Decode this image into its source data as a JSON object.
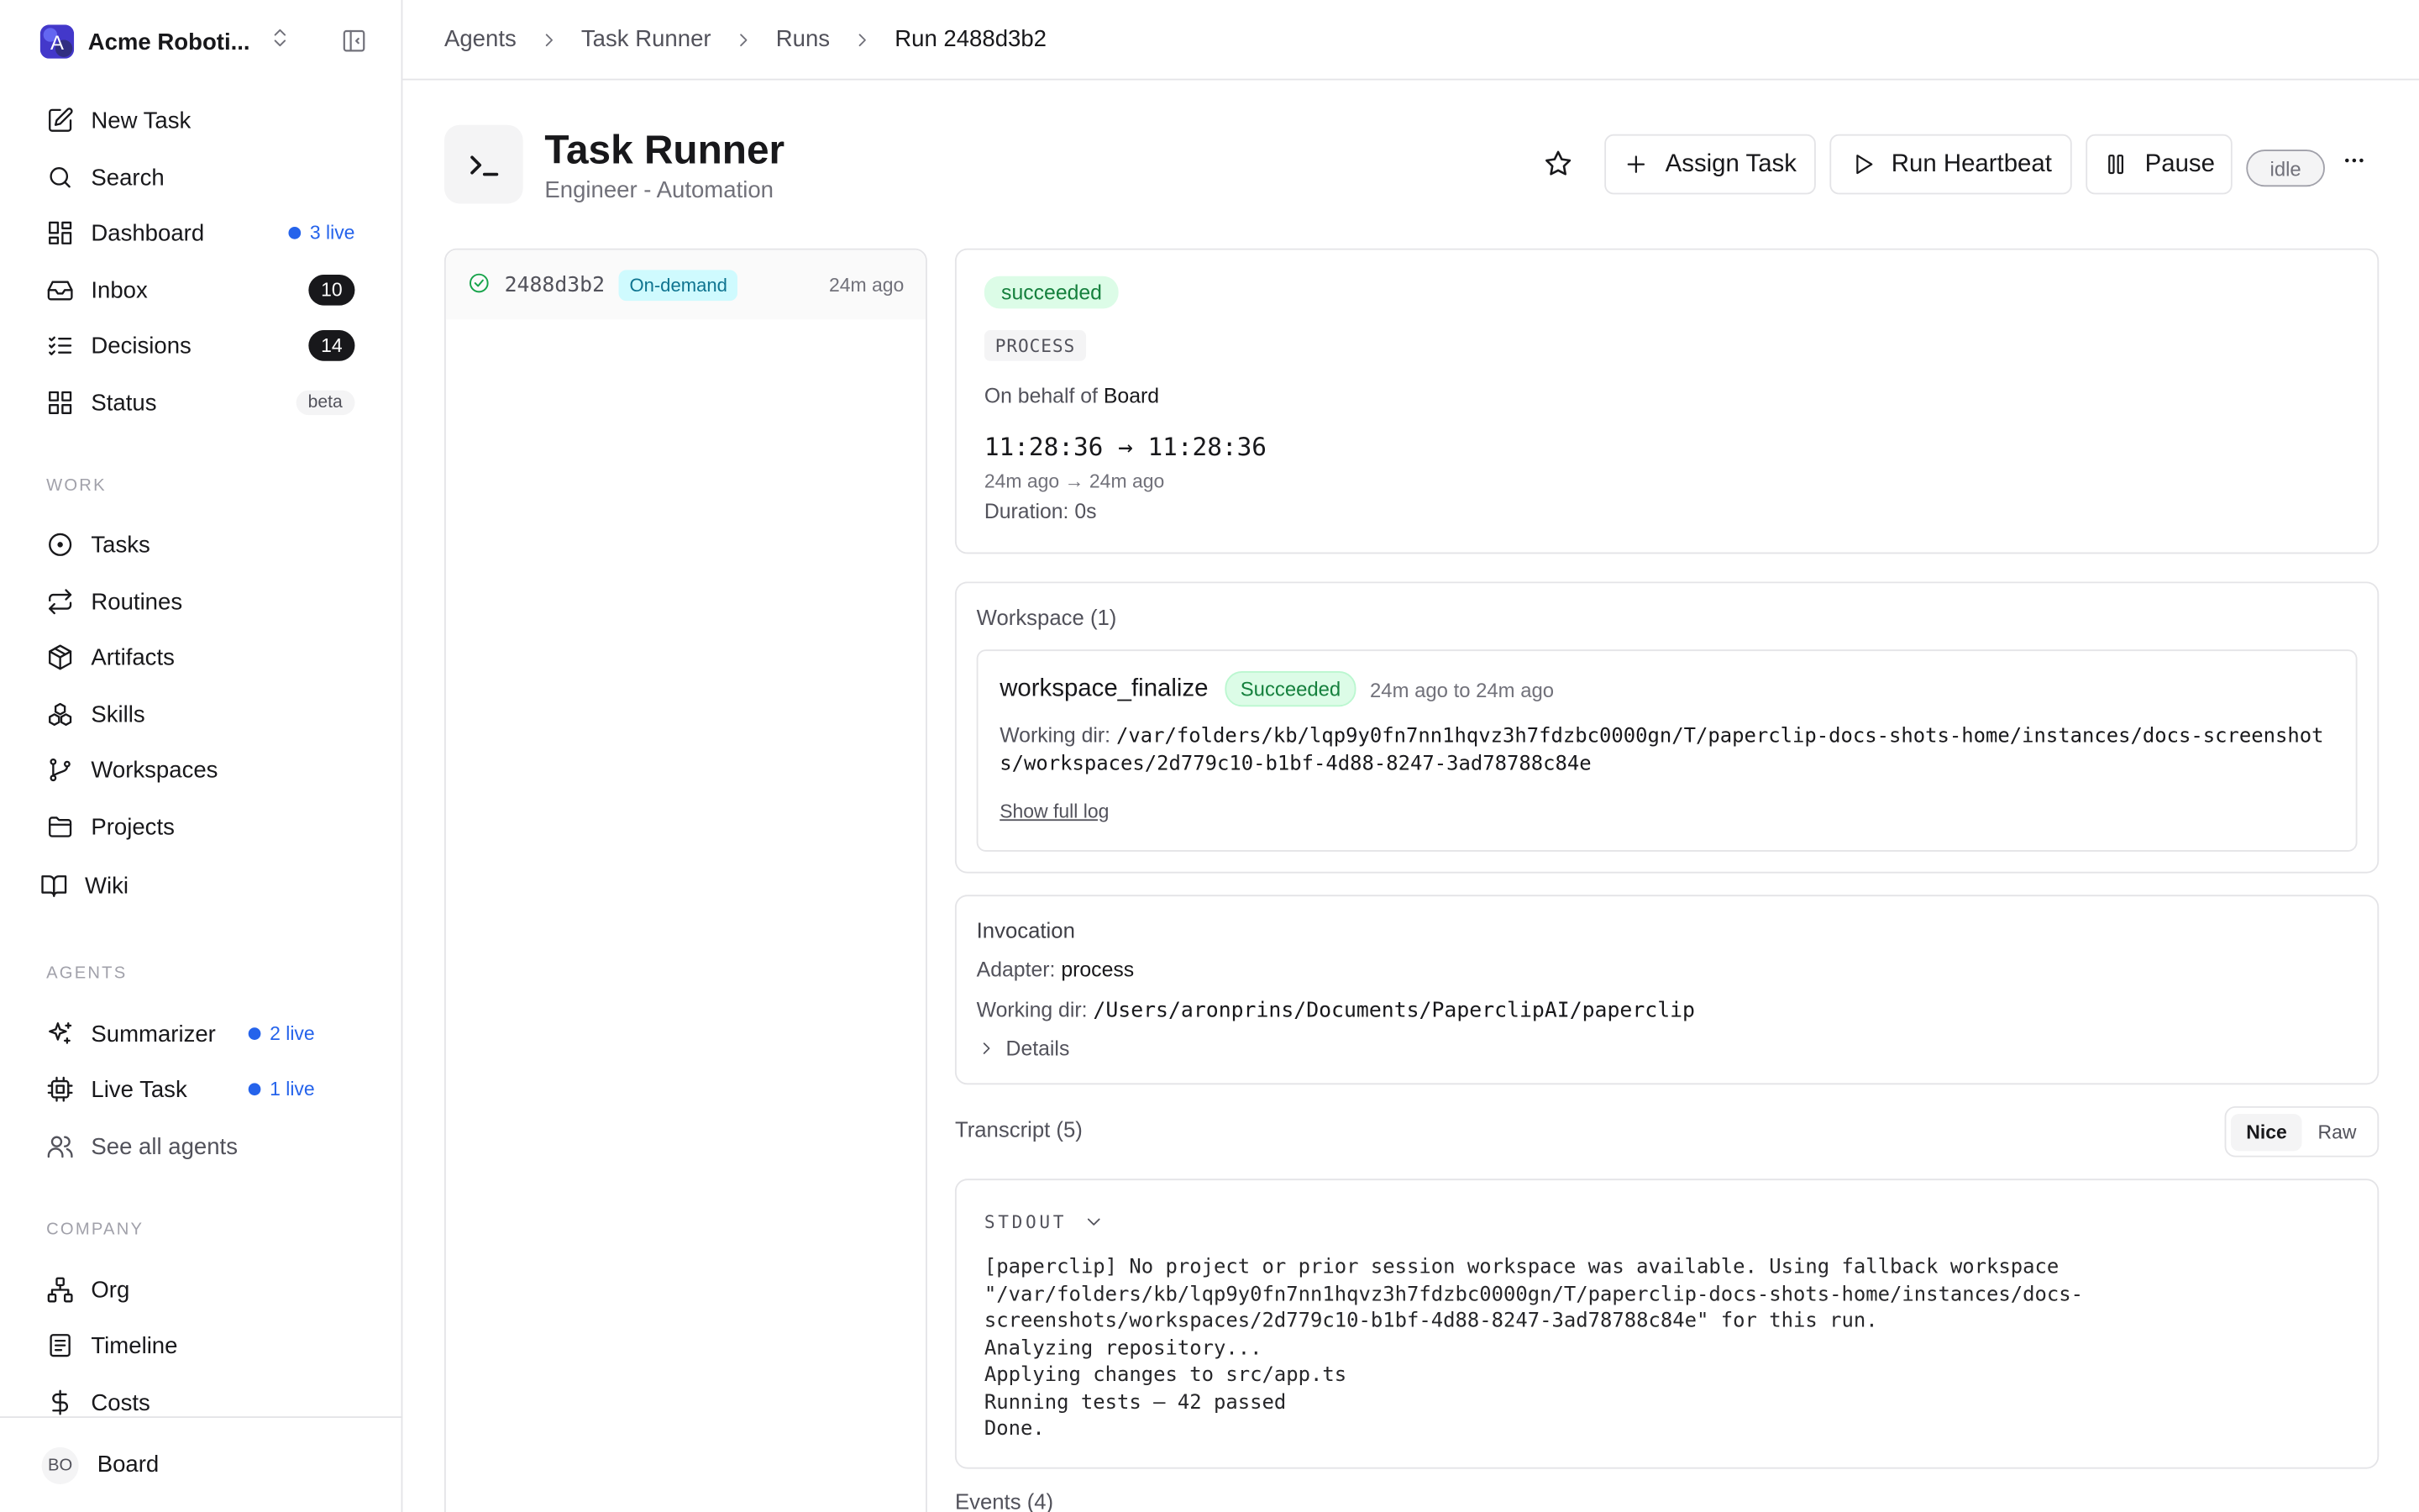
{
  "sidebar": {
    "company_name": "Acme Roboti...",
    "company_initial": "A",
    "main_items": [
      {
        "label": "New Task",
        "icon": "edit-icon"
      },
      {
        "label": "Search",
        "icon": "search-icon"
      },
      {
        "label": "Dashboard",
        "icon": "dashboard-icon",
        "live": "3 live"
      },
      {
        "label": "Inbox",
        "icon": "inbox-icon",
        "count": "10"
      },
      {
        "label": "Decisions",
        "icon": "list-check-icon",
        "count": "14"
      },
      {
        "label": "Status",
        "icon": "grid-icon",
        "badge": "beta"
      }
    ],
    "work_heading": "WORK",
    "work_items": [
      {
        "label": "Tasks",
        "icon": "circle-dot-icon"
      },
      {
        "label": "Routines",
        "icon": "repeat-icon"
      },
      {
        "label": "Artifacts",
        "icon": "package-icon"
      },
      {
        "label": "Skills",
        "icon": "boxes-icon"
      },
      {
        "label": "Workspaces",
        "icon": "git-branch-icon"
      },
      {
        "label": "Projects",
        "icon": "folder-icon"
      },
      {
        "label": "Wiki",
        "icon": "book-icon"
      }
    ],
    "agents_heading": "AGENTS",
    "agent_items": [
      {
        "label": "Summarizer",
        "icon": "sparkles-icon",
        "live": "2 live"
      },
      {
        "label": "Live Task",
        "icon": "cpu-icon",
        "live": "1 live"
      },
      {
        "label": "See all agents",
        "icon": "users-icon"
      }
    ],
    "company_heading": "COMPANY",
    "company_items": [
      {
        "label": "Org",
        "icon": "org-chart-icon"
      },
      {
        "label": "Timeline",
        "icon": "timeline-icon"
      },
      {
        "label": "Costs",
        "icon": "dollar-icon"
      }
    ],
    "user": {
      "initials": "BO",
      "name": "Board"
    }
  },
  "breadcrumb": [
    "Agents",
    "Task Runner",
    "Runs",
    "Run 2488d3b2"
  ],
  "agent": {
    "name": "Task Runner",
    "role": "Engineer - Automation",
    "actions": {
      "assign": "Assign Task",
      "heartbeat": "Run Heartbeat",
      "pause": "Pause"
    },
    "status": "idle"
  },
  "runs": [
    {
      "id": "2488d3b2",
      "trigger": "On-demand",
      "ago": "24m ago",
      "status": "success"
    }
  ],
  "run": {
    "status": "succeeded",
    "kind": "PROCESS",
    "behalf_prefix": "On behalf of",
    "behalf": "Board",
    "time_range": "11:28:36 → 11:28:36",
    "ago_range": "24m ago → 24m ago",
    "duration": "Duration: 0s"
  },
  "workspace": {
    "title": "Workspace (1)",
    "name": "workspace_finalize",
    "status": "Succeeded",
    "range": "24m ago to 24m ago",
    "dir_label": "Working dir:",
    "dir": "/var/folders/kb/lqp9y0fn7nn1hqvz3h7fdzbc0000gn/T/paperclip-docs-shots-home/instances/docs-screenshots/workspaces/2d779c10-b1bf-4d88-8247-3ad78788c84e",
    "log_link": "Show full log"
  },
  "invocation": {
    "title": "Invocation",
    "adapter_label": "Adapter:",
    "adapter": "process",
    "dir_label": "Working dir:",
    "dir": "/Users/aronprins/Documents/PaperclipAI/paperclip",
    "details": "Details"
  },
  "transcript": {
    "title": "Transcript (5)",
    "mode_nice": "Nice",
    "mode_raw": "Raw",
    "stream": "STDOUT",
    "output": "[paperclip] No project or prior session workspace was available. Using fallback workspace \"/var/folders/kb/lqp9y0fn7nn1hqvz3h7fdzbc0000gn/T/paperclip-docs-shots-home/instances/docs-screenshots/workspaces/2d779c10-b1bf-4d88-8247-3ad78788c84e\" for this run.\nAnalyzing repository...\nApplying changes to src/app.ts\nRunning tests — 42 passed\nDone."
  },
  "events_title": "Events (4)"
}
